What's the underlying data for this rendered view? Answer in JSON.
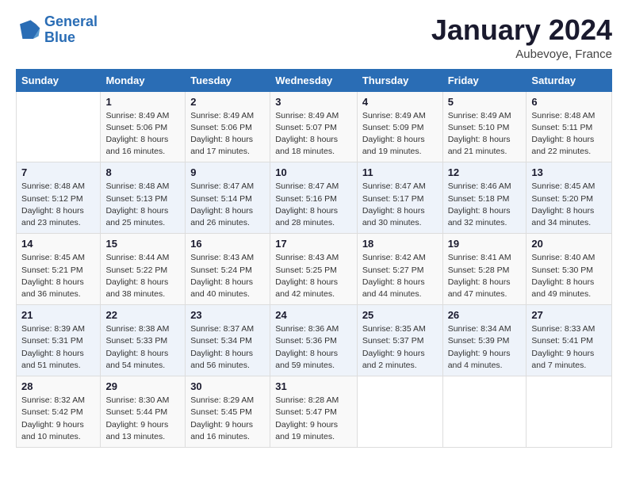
{
  "header": {
    "logo_line1": "General",
    "logo_line2": "Blue",
    "month": "January 2024",
    "location": "Aubevoye, France"
  },
  "weekdays": [
    "Sunday",
    "Monday",
    "Tuesday",
    "Wednesday",
    "Thursday",
    "Friday",
    "Saturday"
  ],
  "weeks": [
    [
      {
        "day": "",
        "sunrise": "",
        "sunset": "",
        "daylight": ""
      },
      {
        "day": "1",
        "sunrise": "Sunrise: 8:49 AM",
        "sunset": "Sunset: 5:06 PM",
        "daylight": "Daylight: 8 hours and 16 minutes."
      },
      {
        "day": "2",
        "sunrise": "Sunrise: 8:49 AM",
        "sunset": "Sunset: 5:06 PM",
        "daylight": "Daylight: 8 hours and 17 minutes."
      },
      {
        "day": "3",
        "sunrise": "Sunrise: 8:49 AM",
        "sunset": "Sunset: 5:07 PM",
        "daylight": "Daylight: 8 hours and 18 minutes."
      },
      {
        "day": "4",
        "sunrise": "Sunrise: 8:49 AM",
        "sunset": "Sunset: 5:09 PM",
        "daylight": "Daylight: 8 hours and 19 minutes."
      },
      {
        "day": "5",
        "sunrise": "Sunrise: 8:49 AM",
        "sunset": "Sunset: 5:10 PM",
        "daylight": "Daylight: 8 hours and 21 minutes."
      },
      {
        "day": "6",
        "sunrise": "Sunrise: 8:48 AM",
        "sunset": "Sunset: 5:11 PM",
        "daylight": "Daylight: 8 hours and 22 minutes."
      }
    ],
    [
      {
        "day": "7",
        "sunrise": "Sunrise: 8:48 AM",
        "sunset": "Sunset: 5:12 PM",
        "daylight": "Daylight: 8 hours and 23 minutes."
      },
      {
        "day": "8",
        "sunrise": "Sunrise: 8:48 AM",
        "sunset": "Sunset: 5:13 PM",
        "daylight": "Daylight: 8 hours and 25 minutes."
      },
      {
        "day": "9",
        "sunrise": "Sunrise: 8:47 AM",
        "sunset": "Sunset: 5:14 PM",
        "daylight": "Daylight: 8 hours and 26 minutes."
      },
      {
        "day": "10",
        "sunrise": "Sunrise: 8:47 AM",
        "sunset": "Sunset: 5:16 PM",
        "daylight": "Daylight: 8 hours and 28 minutes."
      },
      {
        "day": "11",
        "sunrise": "Sunrise: 8:47 AM",
        "sunset": "Sunset: 5:17 PM",
        "daylight": "Daylight: 8 hours and 30 minutes."
      },
      {
        "day": "12",
        "sunrise": "Sunrise: 8:46 AM",
        "sunset": "Sunset: 5:18 PM",
        "daylight": "Daylight: 8 hours and 32 minutes."
      },
      {
        "day": "13",
        "sunrise": "Sunrise: 8:45 AM",
        "sunset": "Sunset: 5:20 PM",
        "daylight": "Daylight: 8 hours and 34 minutes."
      }
    ],
    [
      {
        "day": "14",
        "sunrise": "Sunrise: 8:45 AM",
        "sunset": "Sunset: 5:21 PM",
        "daylight": "Daylight: 8 hours and 36 minutes."
      },
      {
        "day": "15",
        "sunrise": "Sunrise: 8:44 AM",
        "sunset": "Sunset: 5:22 PM",
        "daylight": "Daylight: 8 hours and 38 minutes."
      },
      {
        "day": "16",
        "sunrise": "Sunrise: 8:43 AM",
        "sunset": "Sunset: 5:24 PM",
        "daylight": "Daylight: 8 hours and 40 minutes."
      },
      {
        "day": "17",
        "sunrise": "Sunrise: 8:43 AM",
        "sunset": "Sunset: 5:25 PM",
        "daylight": "Daylight: 8 hours and 42 minutes."
      },
      {
        "day": "18",
        "sunrise": "Sunrise: 8:42 AM",
        "sunset": "Sunset: 5:27 PM",
        "daylight": "Daylight: 8 hours and 44 minutes."
      },
      {
        "day": "19",
        "sunrise": "Sunrise: 8:41 AM",
        "sunset": "Sunset: 5:28 PM",
        "daylight": "Daylight: 8 hours and 47 minutes."
      },
      {
        "day": "20",
        "sunrise": "Sunrise: 8:40 AM",
        "sunset": "Sunset: 5:30 PM",
        "daylight": "Daylight: 8 hours and 49 minutes."
      }
    ],
    [
      {
        "day": "21",
        "sunrise": "Sunrise: 8:39 AM",
        "sunset": "Sunset: 5:31 PM",
        "daylight": "Daylight: 8 hours and 51 minutes."
      },
      {
        "day": "22",
        "sunrise": "Sunrise: 8:38 AM",
        "sunset": "Sunset: 5:33 PM",
        "daylight": "Daylight: 8 hours and 54 minutes."
      },
      {
        "day": "23",
        "sunrise": "Sunrise: 8:37 AM",
        "sunset": "Sunset: 5:34 PM",
        "daylight": "Daylight: 8 hours and 56 minutes."
      },
      {
        "day": "24",
        "sunrise": "Sunrise: 8:36 AM",
        "sunset": "Sunset: 5:36 PM",
        "daylight": "Daylight: 8 hours and 59 minutes."
      },
      {
        "day": "25",
        "sunrise": "Sunrise: 8:35 AM",
        "sunset": "Sunset: 5:37 PM",
        "daylight": "Daylight: 9 hours and 2 minutes."
      },
      {
        "day": "26",
        "sunrise": "Sunrise: 8:34 AM",
        "sunset": "Sunset: 5:39 PM",
        "daylight": "Daylight: 9 hours and 4 minutes."
      },
      {
        "day": "27",
        "sunrise": "Sunrise: 8:33 AM",
        "sunset": "Sunset: 5:41 PM",
        "daylight": "Daylight: 9 hours and 7 minutes."
      }
    ],
    [
      {
        "day": "28",
        "sunrise": "Sunrise: 8:32 AM",
        "sunset": "Sunset: 5:42 PM",
        "daylight": "Daylight: 9 hours and 10 minutes."
      },
      {
        "day": "29",
        "sunrise": "Sunrise: 8:30 AM",
        "sunset": "Sunset: 5:44 PM",
        "daylight": "Daylight: 9 hours and 13 minutes."
      },
      {
        "day": "30",
        "sunrise": "Sunrise: 8:29 AM",
        "sunset": "Sunset: 5:45 PM",
        "daylight": "Daylight: 9 hours and 16 minutes."
      },
      {
        "day": "31",
        "sunrise": "Sunrise: 8:28 AM",
        "sunset": "Sunset: 5:47 PM",
        "daylight": "Daylight: 9 hours and 19 minutes."
      },
      {
        "day": "",
        "sunrise": "",
        "sunset": "",
        "daylight": ""
      },
      {
        "day": "",
        "sunrise": "",
        "sunset": "",
        "daylight": ""
      },
      {
        "day": "",
        "sunrise": "",
        "sunset": "",
        "daylight": ""
      }
    ]
  ]
}
